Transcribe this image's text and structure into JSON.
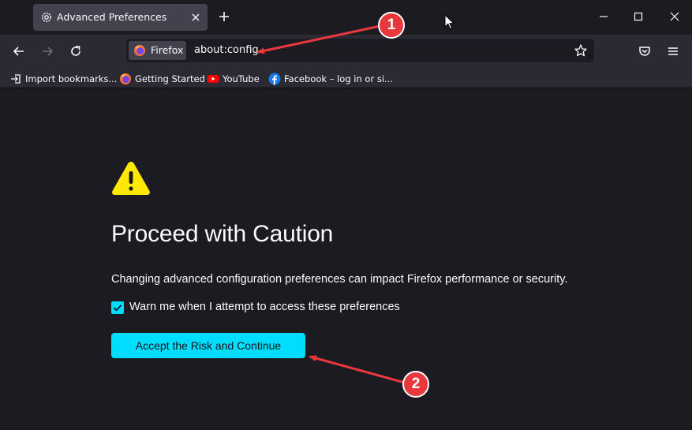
{
  "tab": {
    "title": "Advanced Preferences"
  },
  "urlbar": {
    "identity_label": "Firefox",
    "url": "about:config"
  },
  "bookmarks": [
    {
      "label": "Import bookmarks...",
      "icon": "import-icon"
    },
    {
      "label": "Getting Started",
      "icon": "firefox-icon"
    },
    {
      "label": "YouTube",
      "icon": "youtube-icon"
    },
    {
      "label": "Facebook – log in or si...",
      "icon": "facebook-icon"
    }
  ],
  "page": {
    "heading": "Proceed with Caution",
    "description": "Changing advanced configuration preferences can impact Firefox performance or security.",
    "checkbox_label": "Warn me when I attempt to access these preferences",
    "checkbox_checked": true,
    "accept_label": "Accept the Risk and Continue"
  },
  "annotations": [
    {
      "label": "1"
    },
    {
      "label": "2"
    }
  ],
  "colors": {
    "accent": "#00ddff",
    "annotation": "#e8383d",
    "warning": "#ffe900"
  }
}
